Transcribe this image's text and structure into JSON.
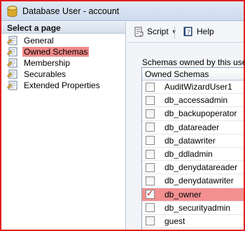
{
  "window": {
    "title": "Database User - account"
  },
  "left_pane": {
    "header": "Select a page",
    "items": [
      {
        "label": "General",
        "icon": "page-icon",
        "selected": false
      },
      {
        "label": "Owned Schemas",
        "icon": "page-icon",
        "selected": true
      },
      {
        "label": "Membership",
        "icon": "page-icon",
        "selected": false
      },
      {
        "label": "Securables",
        "icon": "page-icon",
        "selected": false
      },
      {
        "label": "Extended Properties",
        "icon": "page-icon",
        "selected": false
      }
    ]
  },
  "toolbar": {
    "script_label": "Script",
    "help_label": "Help"
  },
  "schemas": {
    "section_label": "Schemas owned by this user:",
    "column_header": "Owned Schemas",
    "rows": [
      {
        "name": "AuditWizardUser1",
        "checked": false
      },
      {
        "name": "db_accessadmin",
        "checked": false
      },
      {
        "name": "db_backupoperator",
        "checked": false
      },
      {
        "name": "db_datareader",
        "checked": false
      },
      {
        "name": "db_datawriter",
        "checked": false
      },
      {
        "name": "db_ddladmin",
        "checked": false
      },
      {
        "name": "db_denydatareader",
        "checked": false
      },
      {
        "name": "db_denydatawriter",
        "checked": false
      },
      {
        "name": "db_owner",
        "checked": true
      },
      {
        "name": "db_securityadmin",
        "checked": false
      },
      {
        "name": "guest",
        "checked": false
      }
    ]
  },
  "colors": {
    "highlight": "#f08888",
    "title_bg": "#dfe9f5",
    "border_accent": "#e02020"
  }
}
